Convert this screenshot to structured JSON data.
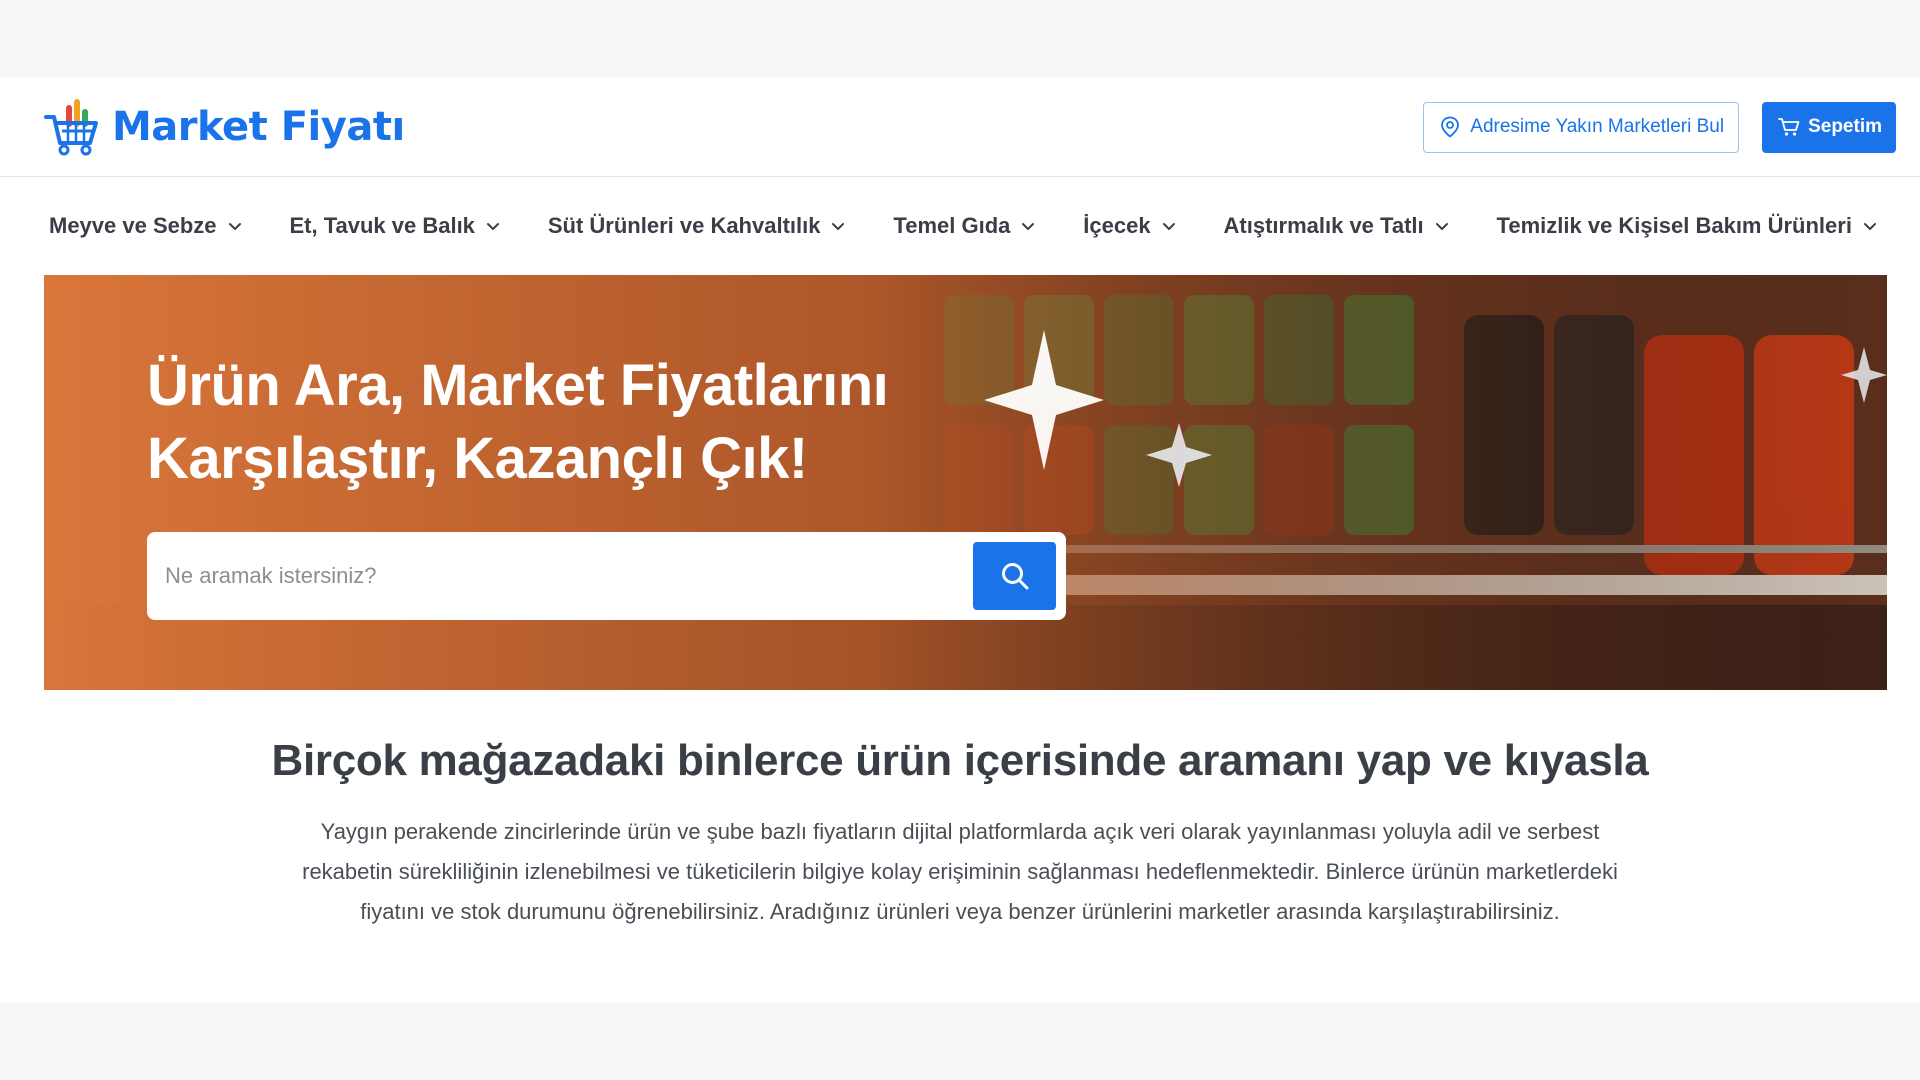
{
  "header": {
    "logo_text": "Market Fiyatı",
    "nearby_button_label": "Adresime Yakın Marketleri Bul",
    "cart_button_label": "Sepetim",
    "brand_color": "#1a73e8"
  },
  "nav": {
    "items": [
      {
        "label": "Meyve ve Sebze"
      },
      {
        "label": "Et, Tavuk ve Balık"
      },
      {
        "label": "Süt Ürünleri ve Kahvaltılık"
      },
      {
        "label": "Temel Gıda"
      },
      {
        "label": "İçecek"
      },
      {
        "label": "Atıştırmalık ve Tatlı"
      },
      {
        "label": "Temizlik ve Kişisel Bakım Ürünleri"
      }
    ]
  },
  "hero": {
    "title_line1": "Ürün Ara, Market Fiyatlarını",
    "title_line2": "Karşılaştır, Kazançlı Çık!",
    "search_placeholder": "Ne aramak istersiniz?",
    "search_value": ""
  },
  "info": {
    "title": "Birçok mağazadaki binlerce ürün içerisinde aramanı yap ve kıyasla",
    "text": "Yaygın perakende zincirlerinde ürün ve şube bazlı fiyatların dijital platformlarda açık veri olarak yayınlanması yoluyla adil ve serbest rekabetin sürekliliğinin izlenebilmesi ve tüketicilerin bilgiye kolay erişiminin sağlanması hedeflenmektedir. Binlerce ürünün marketlerdeki fiyatını ve stok durumunu öğrenebilirsiniz. Aradığınız ürünleri veya benzer ürünlerini marketler arasında karşılaştırabilirsiniz."
  }
}
